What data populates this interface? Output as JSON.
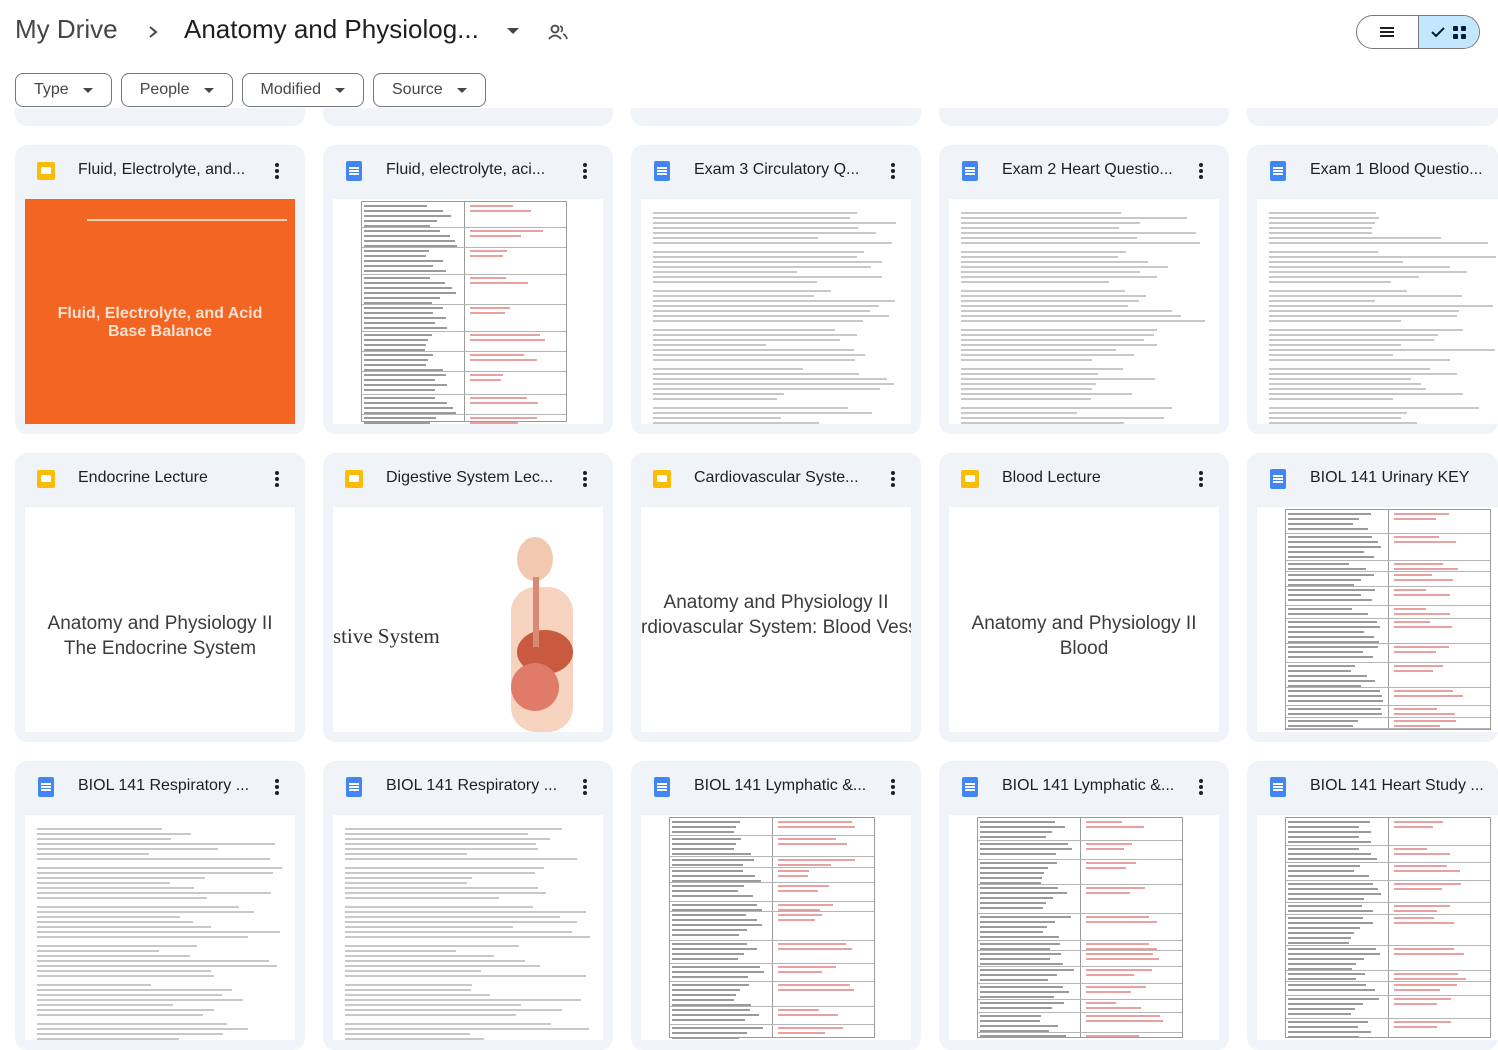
{
  "breadcrumb": {
    "root": "My Drive",
    "current": "Anatomy and Physiolog..."
  },
  "filters": [
    "Type",
    "People",
    "Modified",
    "Source"
  ],
  "cards": [
    {
      "title": "Fluid, Electrolyte, and...",
      "kind": "slides",
      "thumb": "orange",
      "thumb_text": "Fluid, Electrolyte, and Acid Base Balance"
    },
    {
      "title": "Fluid, electrolyte, aci...",
      "kind": "docs",
      "thumb": "table"
    },
    {
      "title": "Exam 3 Circulatory Q...",
      "kind": "docs",
      "thumb": "lines"
    },
    {
      "title": "Exam 2 Heart Questio...",
      "kind": "docs",
      "thumb": "lines"
    },
    {
      "title": "Exam 1 Blood Questio...",
      "kind": "docs",
      "thumb": "lines"
    },
    {
      "title": "Endocrine Lecture",
      "kind": "slides",
      "thumb": "text",
      "thumb_line1": "Anatomy and Physiology II",
      "thumb_line2": "The Endocrine System"
    },
    {
      "title": "Digestive System Lec...",
      "kind": "slides",
      "thumb": "digestive",
      "thumb_line1": "stive System"
    },
    {
      "title": "Cardiovascular Syste...",
      "kind": "slides",
      "thumb": "text",
      "thumb_line1": "Anatomy and Physiology II",
      "thumb_line2": "rdiovascular System: Blood Vess"
    },
    {
      "title": "Blood Lecture",
      "kind": "slides",
      "thumb": "text",
      "thumb_line1": "Anatomy and Physiology II",
      "thumb_line2": "Blood"
    },
    {
      "title": "BIOL 141 Urinary KEY",
      "kind": "docs",
      "thumb": "table"
    },
    {
      "title": "BIOL 141 Respiratory ...",
      "kind": "docs",
      "thumb": "lines"
    },
    {
      "title": "BIOL 141 Respiratory ...",
      "kind": "docs",
      "thumb": "lines"
    },
    {
      "title": "BIOL 141 Lymphatic &...",
      "kind": "docs",
      "thumb": "table"
    },
    {
      "title": "BIOL 141 Lymphatic &...",
      "kind": "docs",
      "thumb": "table"
    },
    {
      "title": "BIOL 141 Heart Study ...",
      "kind": "docs",
      "thumb": "table"
    }
  ],
  "colors": {
    "accent": "#c2e7ff",
    "card_bg": "#f0f4f9",
    "slides": "#fbbc04",
    "docs": "#4285f4",
    "orange_slide": "#f26522"
  }
}
